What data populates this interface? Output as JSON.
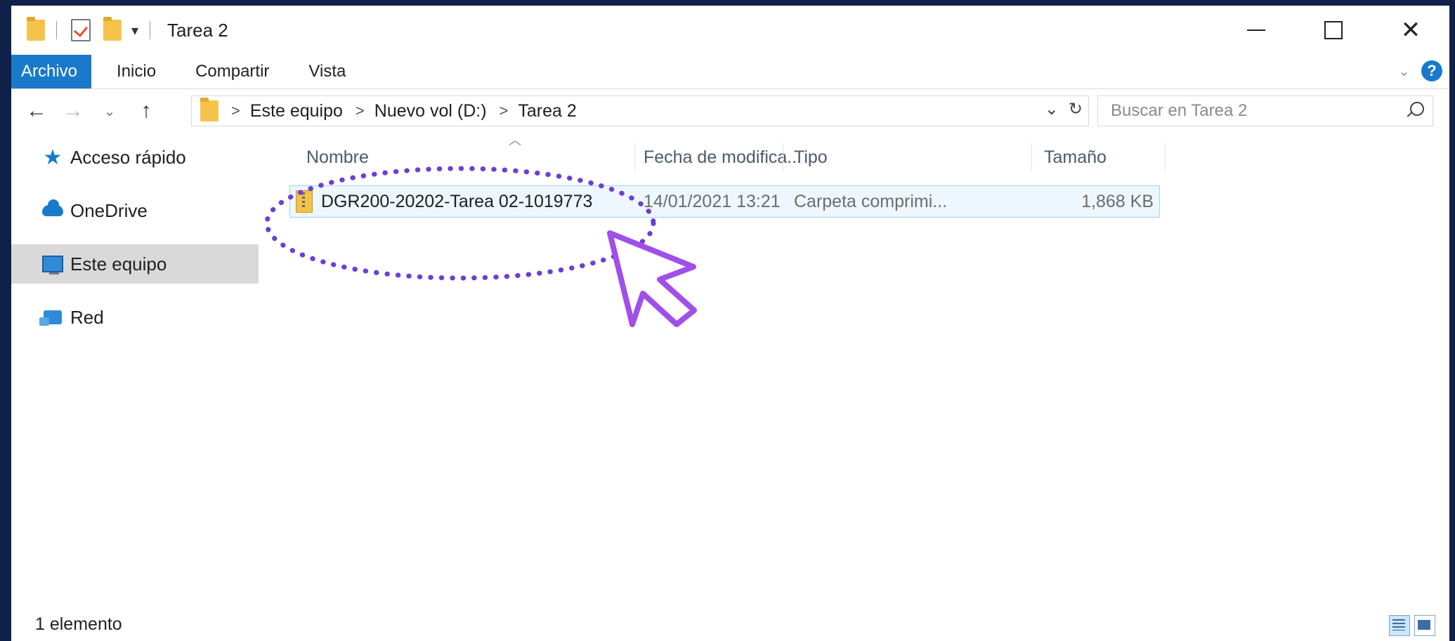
{
  "window": {
    "title": "Tarea 2",
    "qa_caret": "▾"
  },
  "ribbon": {
    "tabs": [
      "Archivo",
      "Inicio",
      "Compartir",
      "Vista"
    ],
    "help_label": "?"
  },
  "address": {
    "breadcrumbs": [
      "Este equipo",
      "Nuevo vol (D:)",
      "Tarea 2"
    ],
    "separator": ">",
    "search_placeholder": "Buscar en Tarea 2"
  },
  "sidebar": {
    "items": [
      {
        "label": "Acceso rápido",
        "icon": "star-icon"
      },
      {
        "label": "OneDrive",
        "icon": "cloud-icon"
      },
      {
        "label": "Este equipo",
        "icon": "computer-icon",
        "selected": true
      },
      {
        "label": "Red",
        "icon": "network-icon"
      }
    ]
  },
  "columns": {
    "name": "Nombre",
    "date": "Fecha de modifica...",
    "type": "Tipo",
    "size": "Tamaño"
  },
  "files": [
    {
      "name": "DGR200-20202-Tarea 02-1019773",
      "date": "14/01/2021 13:21",
      "type": "Carpeta comprimi...",
      "size": "1,868 KB",
      "icon": "zip-folder-icon"
    }
  ],
  "status": {
    "count_text": "1 elemento"
  },
  "colors": {
    "accent": "#1979ca",
    "selection": "#eef7fd",
    "selection_border": "#9fd3f5",
    "annotation": "#6a3fd6",
    "cursor": "#a04fe8",
    "frame": "#0f2149"
  }
}
